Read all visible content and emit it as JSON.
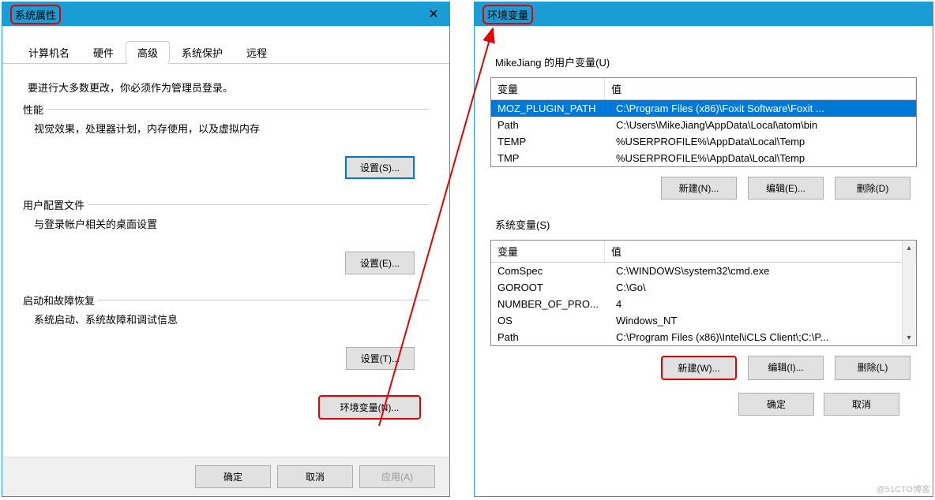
{
  "window1": {
    "title": "系统属性",
    "close": "✕",
    "tabs": [
      "计算机名",
      "硬件",
      "高级",
      "系统保护",
      "远程"
    ],
    "active_tab_index": 2,
    "note": "要进行大多数更改，你必须作为管理员登录。",
    "groups": {
      "perf": {
        "title": "性能",
        "desc": "视觉效果，处理器计划，内存使用，以及虚拟内存",
        "btn": "设置(S)..."
      },
      "profile": {
        "title": "用户配置文件",
        "desc": "与登录帐户相关的桌面设置",
        "btn": "设置(E)..."
      },
      "startup": {
        "title": "启动和故障恢复",
        "desc": "系统启动、系统故障和调试信息",
        "btn": "设置(T)..."
      }
    },
    "envbtn": "环境变量(N)...",
    "dlgbtns": {
      "ok": "确定",
      "cancel": "取消",
      "apply": "应用(A)"
    }
  },
  "window2": {
    "title": "环境变量",
    "user_section": "MikeJiang 的用户变量(U)",
    "headers": {
      "var": "变量",
      "val": "值"
    },
    "user_vars": [
      {
        "name": "MOZ_PLUGIN_PATH",
        "value": "C:\\Program Files (x86)\\Foxit Software\\Foxit ...",
        "selected": true
      },
      {
        "name": "Path",
        "value": "C:\\Users\\MikeJiang\\AppData\\Local\\atom\\bin"
      },
      {
        "name": "TEMP",
        "value": "%USERPROFILE%\\AppData\\Local\\Temp"
      },
      {
        "name": "TMP",
        "value": "%USERPROFILE%\\AppData\\Local\\Temp"
      }
    ],
    "user_btns": {
      "new": "新建(N)...",
      "edit": "编辑(E)...",
      "del": "删除(D)"
    },
    "sys_section": "系统变量(S)",
    "sys_vars": [
      {
        "name": "ComSpec",
        "value": "C:\\WINDOWS\\system32\\cmd.exe"
      },
      {
        "name": "GOROOT",
        "value": "C:\\Go\\"
      },
      {
        "name": "NUMBER_OF_PRO...",
        "value": "4"
      },
      {
        "name": "OS",
        "value": "Windows_NT"
      },
      {
        "name": "Path",
        "value": "C:\\Program Files (x86)\\Intel\\iCLS Client\\;C:\\P..."
      }
    ],
    "sys_btns": {
      "new": "新建(W)...",
      "edit": "编辑(I)...",
      "del": "删除(L)"
    },
    "dlgbtns": {
      "ok": "确定",
      "cancel": "取消"
    }
  },
  "watermark": "@51CTO博客"
}
